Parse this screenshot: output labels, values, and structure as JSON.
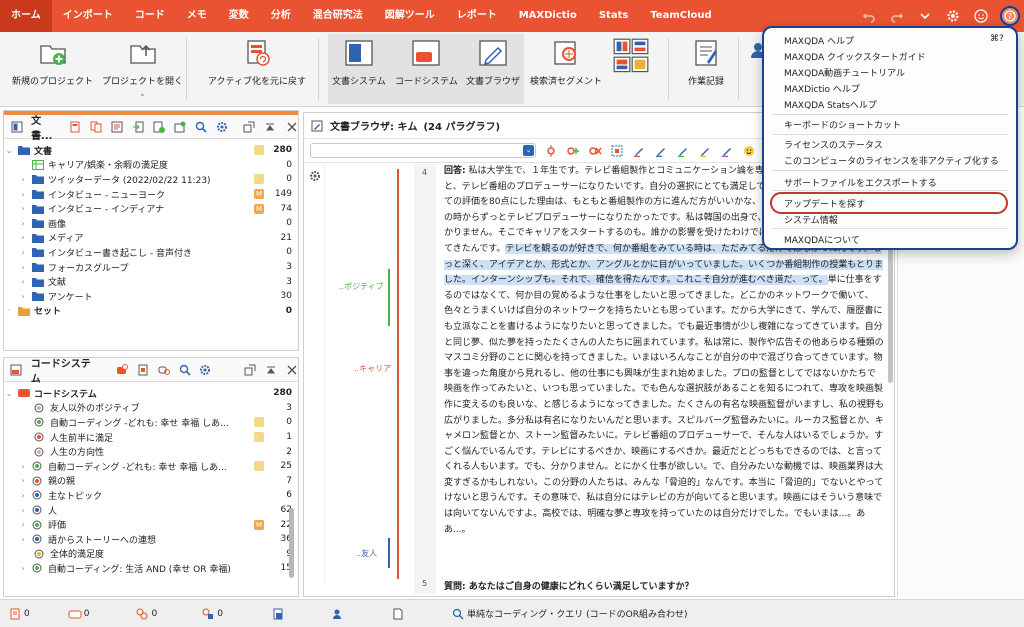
{
  "tabs": [
    "ホーム",
    "インポート",
    "コード",
    "メモ",
    "変数",
    "分析",
    "混合研究法",
    "図解ツール",
    "レポート",
    "MAXDictio",
    "Stats",
    "TeamCloud"
  ],
  "ribbon": {
    "new_project": "新規のプロジェクト",
    "open_project": "プロジェクトを開く",
    "undo_activation": "アクティブ化を元に戻す",
    "doc_system": "文書システム",
    "code_system": "コードシステム",
    "doc_browser": "文書ブラウザ",
    "retrieved_segments": "検索済セグメント",
    "logbook": "作業記録"
  },
  "doc_panel": {
    "title": "文書...",
    "root": {
      "label": "文書",
      "count": "280"
    },
    "items": [
      {
        "label": "キャリア/娯楽・余暇の満足度",
        "count": "0",
        "memo": ""
      },
      {
        "label": "ツイッターデータ (2022/02/22 11:23)",
        "count": "0",
        "memo": "y"
      },
      {
        "label": "インタビュー - ニューヨーク",
        "count": "149",
        "memo": "M"
      },
      {
        "label": "インタビュー - インディアナ",
        "count": "74",
        "memo": "M"
      },
      {
        "label": "画像",
        "count": "0",
        "memo": ""
      },
      {
        "label": "メディア",
        "count": "21",
        "memo": ""
      },
      {
        "label": "インタビュー書き起こし - 音声付き",
        "count": "0",
        "memo": ""
      },
      {
        "label": "フォーカスグループ",
        "count": "3",
        "memo": ""
      },
      {
        "label": "文献",
        "count": "3",
        "memo": ""
      },
      {
        "label": "アンケート",
        "count": "30",
        "memo": ""
      }
    ],
    "sets": {
      "label": "セット",
      "count": "0"
    }
  },
  "code_panel": {
    "title": "コードシステム",
    "root": {
      "label": "コードシステム",
      "count": "280"
    },
    "items": [
      {
        "label": "友人以外のポジティブ",
        "count": "3",
        "memo": ""
      },
      {
        "label": "自動コーディング -どれも: 幸せ 幸福 しあ...",
        "count": "0",
        "memo": "y"
      },
      {
        "label": "人生前半に満足",
        "count": "1",
        "memo": "y"
      },
      {
        "label": "人生の方向性",
        "count": "2",
        "memo": ""
      },
      {
        "label": "自動コーディング -どれも: 幸せ 幸福 しあ...",
        "count": "25",
        "memo": "y"
      },
      {
        "label": "親の親",
        "count": "7",
        "memo": ""
      },
      {
        "label": "主なトピック",
        "count": "6",
        "memo": ""
      },
      {
        "label": "人",
        "count": "62",
        "memo": ""
      },
      {
        "label": "評価",
        "count": "22",
        "memo": "M"
      },
      {
        "label": "語からストーリーへの連想",
        "count": "36",
        "memo": ""
      },
      {
        "label": "全体的満足度",
        "count": "9",
        "memo": ""
      },
      {
        "label": "自動コーディング: 生活 AND (幸せ OR 幸福)",
        "count": "15",
        "memo": ""
      }
    ]
  },
  "browser": {
    "title": "文書ブラウザ: キム",
    "paragraphs": "(24 パラグラフ)",
    "para_num": "4",
    "para_num2": "5",
    "label_bold": "回答:",
    "text_pre": " 私は大学生で、１年生です。テレビ番組製作とコミュニケーション論を専攻し指しています。そのあと、テレビ番組のプロデューサーになりたいです。自分の選択にとても満足しています。キャリアパスについての評価を80点にした理由は、もともと番組製作の方に進んだ方がいいかな、と迷っているからです。高校の時からずっとテレビプロデューサーになりたかったです。私は韓国の出身で、いつか韓国に帰るのはまだ分かりません。そこでキャリアをスタートするのも。誰かの影響を受けたわけではなく、自分自身でそう思ってきたんです。",
    "text_hl": "テレビを観るのが好きで、何か番組をみている時は、ただみてるだけではなかったんです。もっと深く、アイデアとか、形式とか、アングルとかに目がいっていました。いくつか番組制作の授業もとりました。インターンシップも。それで、確信を得たんです。これこそ自分が進むべき道だ、って。",
    "text_post": "単に仕事をするのではなくて、何か目の覚めるような仕事をしたいと思ってきました。どこかのネットワークで働いて、色々とうまくいけば自分のネットワークを持ちたいとも思っています。だから大学にきて、学んで、履歴書にも立派なことを書けるようになりたいと思ってきました。でも最近事情が少し複雑になってきています。自分と同じ夢、似た夢を持ったたくさんの人たちに囲まれています。私は常に、製作や広告その他あらゆる種類のマスコミ分野のことに関心を持ってきました。いまはいろんなことが自分の中で混ざり合ってきています。物事を違った角度から見れるし、他の仕事にも興味が生まれ始めました。プロの監督としてではないかたちで映画を作ってみたいと、いつも思っていました。でも色んな選択肢があることを知るにつれて、専攻を映画製作に変えるのも良いな、と感じるようになってきました。たくさんの有名な映画監督がいますし、私の視野も広がりました。多分私は有名になりたいんだと思います。スピルバーグ監督みたいに。ルーカス監督とか、キャメロン監督とか、ストーン監督みたいに。テレビ番組のプロデューサーで、そんな人はいるでしょうか。すごく悩んでいるんです。テレビにするべきか、映画にするべきか。最近だとどっちもできるのでは、と言ってくれる人もいます。でも、分かりません。とにかく仕事が欲しい。で、自分みたいな動機では、映画業界は大変すぎるかもしれない。この分野の人たちは、みんな「脅迫的」なんです。本当に「脅迫的」でないとやってけないと思うんです。その意味で、私は自分にはテレビの方が向いてると思います。映画にはそういう意味では向いてないんですよ。高校では、明確な夢と専攻を持っていたのは自分だけでした。でもいまは...。ああ...。",
    "next_label": "質問:",
    "next_text": " あなたはご自身の健康にどれくらい満足していますか？",
    "code_positive": "..ポジティブ",
    "code_career": "..キャリア",
    "code_friend": "..友人"
  },
  "menu": {
    "help": "MAXQDA ヘルプ",
    "help_shortcut": "⌘?",
    "quickstart": "MAXQDA クイックスタートガイド",
    "video": "MAXQDA動画チュートリアル",
    "dictio_help": "MAXDictio ヘルプ",
    "stats_help": "MAXQDA Statsヘルプ",
    "shortcuts": "キーボードのショートカット",
    "license_status": "ライセンスのステータス",
    "deactivate": "このコンピュータのライセンスを非アクティブ化する",
    "export_support": "サポートファイルをエクスポートする",
    "check_updates": "アップデートを探す",
    "system_info": "システム情報",
    "about": "MAXQDAについて"
  },
  "status": {
    "c1": "0",
    "c2": "0",
    "c3": "0",
    "c4": "0",
    "query": "単純なコーディング・クエリ (コードのOR組み合わせ)"
  }
}
